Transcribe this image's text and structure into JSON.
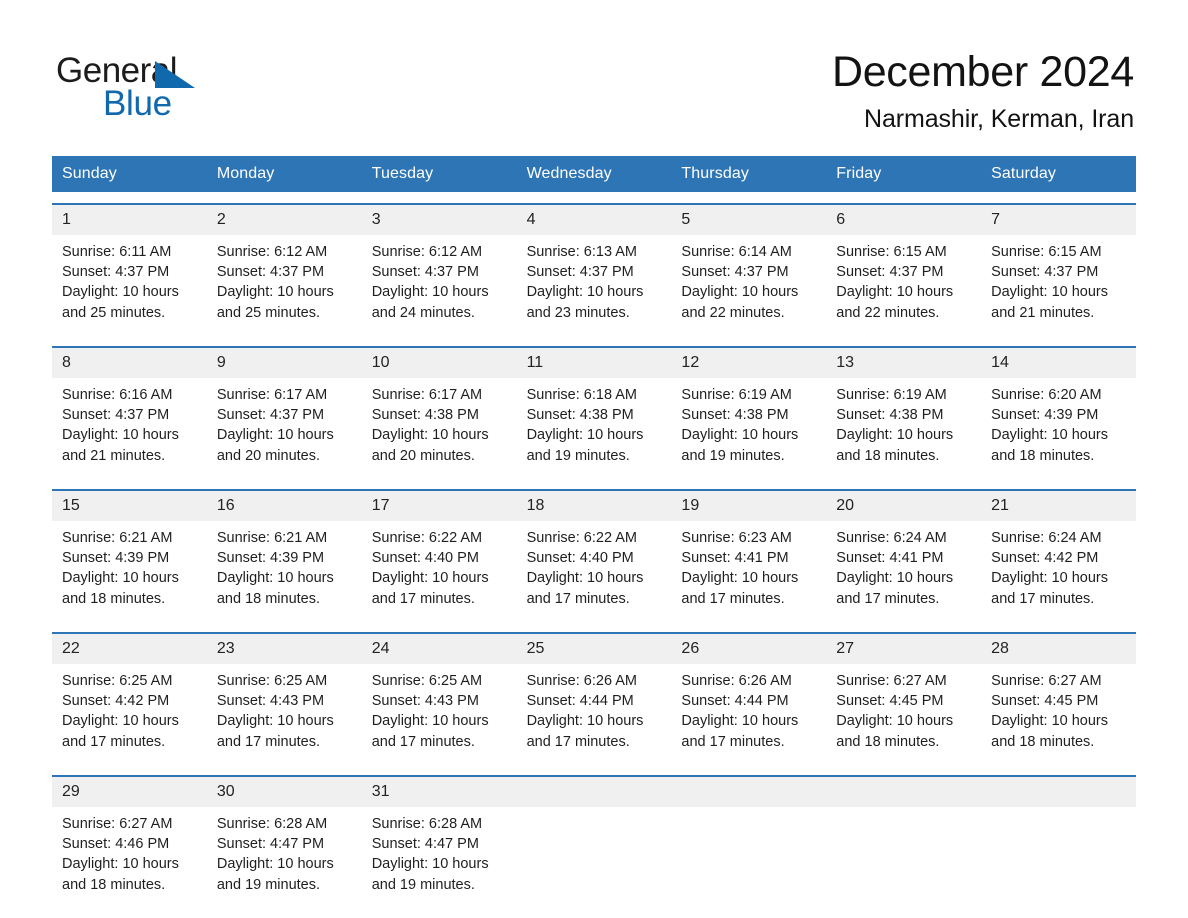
{
  "brand": {
    "name_part1": "General",
    "name_part2": "Blue",
    "accent_color": "#1068ad",
    "triangle_icon": "brand-triangle-icon"
  },
  "header": {
    "title": "December 2024",
    "location": "Narmashir, Kerman, Iran"
  },
  "theme": {
    "header_blue": "#2e75b6",
    "date_band_gray": "#f0f0f0",
    "text_dark": "#1f1f1f"
  },
  "calendar": {
    "weekdays": [
      "Sunday",
      "Monday",
      "Tuesday",
      "Wednesday",
      "Thursday",
      "Friday",
      "Saturday"
    ],
    "weeks": [
      {
        "dates": [
          "1",
          "2",
          "3",
          "4",
          "5",
          "6",
          "7"
        ],
        "cells": [
          {
            "date": "1",
            "sunrise": "Sunrise: 6:11 AM",
            "sunset": "Sunset: 4:37 PM",
            "daylight1": "Daylight: 10 hours",
            "daylight2": "and 25 minutes."
          },
          {
            "date": "2",
            "sunrise": "Sunrise: 6:12 AM",
            "sunset": "Sunset: 4:37 PM",
            "daylight1": "Daylight: 10 hours",
            "daylight2": "and 25 minutes."
          },
          {
            "date": "3",
            "sunrise": "Sunrise: 6:12 AM",
            "sunset": "Sunset: 4:37 PM",
            "daylight1": "Daylight: 10 hours",
            "daylight2": "and 24 minutes."
          },
          {
            "date": "4",
            "sunrise": "Sunrise: 6:13 AM",
            "sunset": "Sunset: 4:37 PM",
            "daylight1": "Daylight: 10 hours",
            "daylight2": "and 23 minutes."
          },
          {
            "date": "5",
            "sunrise": "Sunrise: 6:14 AM",
            "sunset": "Sunset: 4:37 PM",
            "daylight1": "Daylight: 10 hours",
            "daylight2": "and 22 minutes."
          },
          {
            "date": "6",
            "sunrise": "Sunrise: 6:15 AM",
            "sunset": "Sunset: 4:37 PM",
            "daylight1": "Daylight: 10 hours",
            "daylight2": "and 22 minutes."
          },
          {
            "date": "7",
            "sunrise": "Sunrise: 6:15 AM",
            "sunset": "Sunset: 4:37 PM",
            "daylight1": "Daylight: 10 hours",
            "daylight2": "and 21 minutes."
          }
        ]
      },
      {
        "dates": [
          "8",
          "9",
          "10",
          "11",
          "12",
          "13",
          "14"
        ],
        "cells": [
          {
            "date": "8",
            "sunrise": "Sunrise: 6:16 AM",
            "sunset": "Sunset: 4:37 PM",
            "daylight1": "Daylight: 10 hours",
            "daylight2": "and 21 minutes."
          },
          {
            "date": "9",
            "sunrise": "Sunrise: 6:17 AM",
            "sunset": "Sunset: 4:37 PM",
            "daylight1": "Daylight: 10 hours",
            "daylight2": "and 20 minutes."
          },
          {
            "date": "10",
            "sunrise": "Sunrise: 6:17 AM",
            "sunset": "Sunset: 4:38 PM",
            "daylight1": "Daylight: 10 hours",
            "daylight2": "and 20 minutes."
          },
          {
            "date": "11",
            "sunrise": "Sunrise: 6:18 AM",
            "sunset": "Sunset: 4:38 PM",
            "daylight1": "Daylight: 10 hours",
            "daylight2": "and 19 minutes."
          },
          {
            "date": "12",
            "sunrise": "Sunrise: 6:19 AM",
            "sunset": "Sunset: 4:38 PM",
            "daylight1": "Daylight: 10 hours",
            "daylight2": "and 19 minutes."
          },
          {
            "date": "13",
            "sunrise": "Sunrise: 6:19 AM",
            "sunset": "Sunset: 4:38 PM",
            "daylight1": "Daylight: 10 hours",
            "daylight2": "and 18 minutes."
          },
          {
            "date": "14",
            "sunrise": "Sunrise: 6:20 AM",
            "sunset": "Sunset: 4:39 PM",
            "daylight1": "Daylight: 10 hours",
            "daylight2": "and 18 minutes."
          }
        ]
      },
      {
        "dates": [
          "15",
          "16",
          "17",
          "18",
          "19",
          "20",
          "21"
        ],
        "cells": [
          {
            "date": "15",
            "sunrise": "Sunrise: 6:21 AM",
            "sunset": "Sunset: 4:39 PM",
            "daylight1": "Daylight: 10 hours",
            "daylight2": "and 18 minutes."
          },
          {
            "date": "16",
            "sunrise": "Sunrise: 6:21 AM",
            "sunset": "Sunset: 4:39 PM",
            "daylight1": "Daylight: 10 hours",
            "daylight2": "and 18 minutes."
          },
          {
            "date": "17",
            "sunrise": "Sunrise: 6:22 AM",
            "sunset": "Sunset: 4:40 PM",
            "daylight1": "Daylight: 10 hours",
            "daylight2": "and 17 minutes."
          },
          {
            "date": "18",
            "sunrise": "Sunrise: 6:22 AM",
            "sunset": "Sunset: 4:40 PM",
            "daylight1": "Daylight: 10 hours",
            "daylight2": "and 17 minutes."
          },
          {
            "date": "19",
            "sunrise": "Sunrise: 6:23 AM",
            "sunset": "Sunset: 4:41 PM",
            "daylight1": "Daylight: 10 hours",
            "daylight2": "and 17 minutes."
          },
          {
            "date": "20",
            "sunrise": "Sunrise: 6:24 AM",
            "sunset": "Sunset: 4:41 PM",
            "daylight1": "Daylight: 10 hours",
            "daylight2": "and 17 minutes."
          },
          {
            "date": "21",
            "sunrise": "Sunrise: 6:24 AM",
            "sunset": "Sunset: 4:42 PM",
            "daylight1": "Daylight: 10 hours",
            "daylight2": "and 17 minutes."
          }
        ]
      },
      {
        "dates": [
          "22",
          "23",
          "24",
          "25",
          "26",
          "27",
          "28"
        ],
        "cells": [
          {
            "date": "22",
            "sunrise": "Sunrise: 6:25 AM",
            "sunset": "Sunset: 4:42 PM",
            "daylight1": "Daylight: 10 hours",
            "daylight2": "and 17 minutes."
          },
          {
            "date": "23",
            "sunrise": "Sunrise: 6:25 AM",
            "sunset": "Sunset: 4:43 PM",
            "daylight1": "Daylight: 10 hours",
            "daylight2": "and 17 minutes."
          },
          {
            "date": "24",
            "sunrise": "Sunrise: 6:25 AM",
            "sunset": "Sunset: 4:43 PM",
            "daylight1": "Daylight: 10 hours",
            "daylight2": "and 17 minutes."
          },
          {
            "date": "25",
            "sunrise": "Sunrise: 6:26 AM",
            "sunset": "Sunset: 4:44 PM",
            "daylight1": "Daylight: 10 hours",
            "daylight2": "and 17 minutes."
          },
          {
            "date": "26",
            "sunrise": "Sunrise: 6:26 AM",
            "sunset": "Sunset: 4:44 PM",
            "daylight1": "Daylight: 10 hours",
            "daylight2": "and 17 minutes."
          },
          {
            "date": "27",
            "sunrise": "Sunrise: 6:27 AM",
            "sunset": "Sunset: 4:45 PM",
            "daylight1": "Daylight: 10 hours",
            "daylight2": "and 18 minutes."
          },
          {
            "date": "28",
            "sunrise": "Sunrise: 6:27 AM",
            "sunset": "Sunset: 4:45 PM",
            "daylight1": "Daylight: 10 hours",
            "daylight2": "and 18 minutes."
          }
        ]
      },
      {
        "dates": [
          "29",
          "30",
          "31",
          "",
          "",
          "",
          ""
        ],
        "cells": [
          {
            "date": "29",
            "sunrise": "Sunrise: 6:27 AM",
            "sunset": "Sunset: 4:46 PM",
            "daylight1": "Daylight: 10 hours",
            "daylight2": "and 18 minutes."
          },
          {
            "date": "30",
            "sunrise": "Sunrise: 6:28 AM",
            "sunset": "Sunset: 4:47 PM",
            "daylight1": "Daylight: 10 hours",
            "daylight2": "and 19 minutes."
          },
          {
            "date": "31",
            "sunrise": "Sunrise: 6:28 AM",
            "sunset": "Sunset: 4:47 PM",
            "daylight1": "Daylight: 10 hours",
            "daylight2": "and 19 minutes."
          },
          {
            "date": "",
            "sunrise": "",
            "sunset": "",
            "daylight1": "",
            "daylight2": ""
          },
          {
            "date": "",
            "sunrise": "",
            "sunset": "",
            "daylight1": "",
            "daylight2": ""
          },
          {
            "date": "",
            "sunrise": "",
            "sunset": "",
            "daylight1": "",
            "daylight2": ""
          },
          {
            "date": "",
            "sunrise": "",
            "sunset": "",
            "daylight1": "",
            "daylight2": ""
          }
        ]
      }
    ]
  }
}
